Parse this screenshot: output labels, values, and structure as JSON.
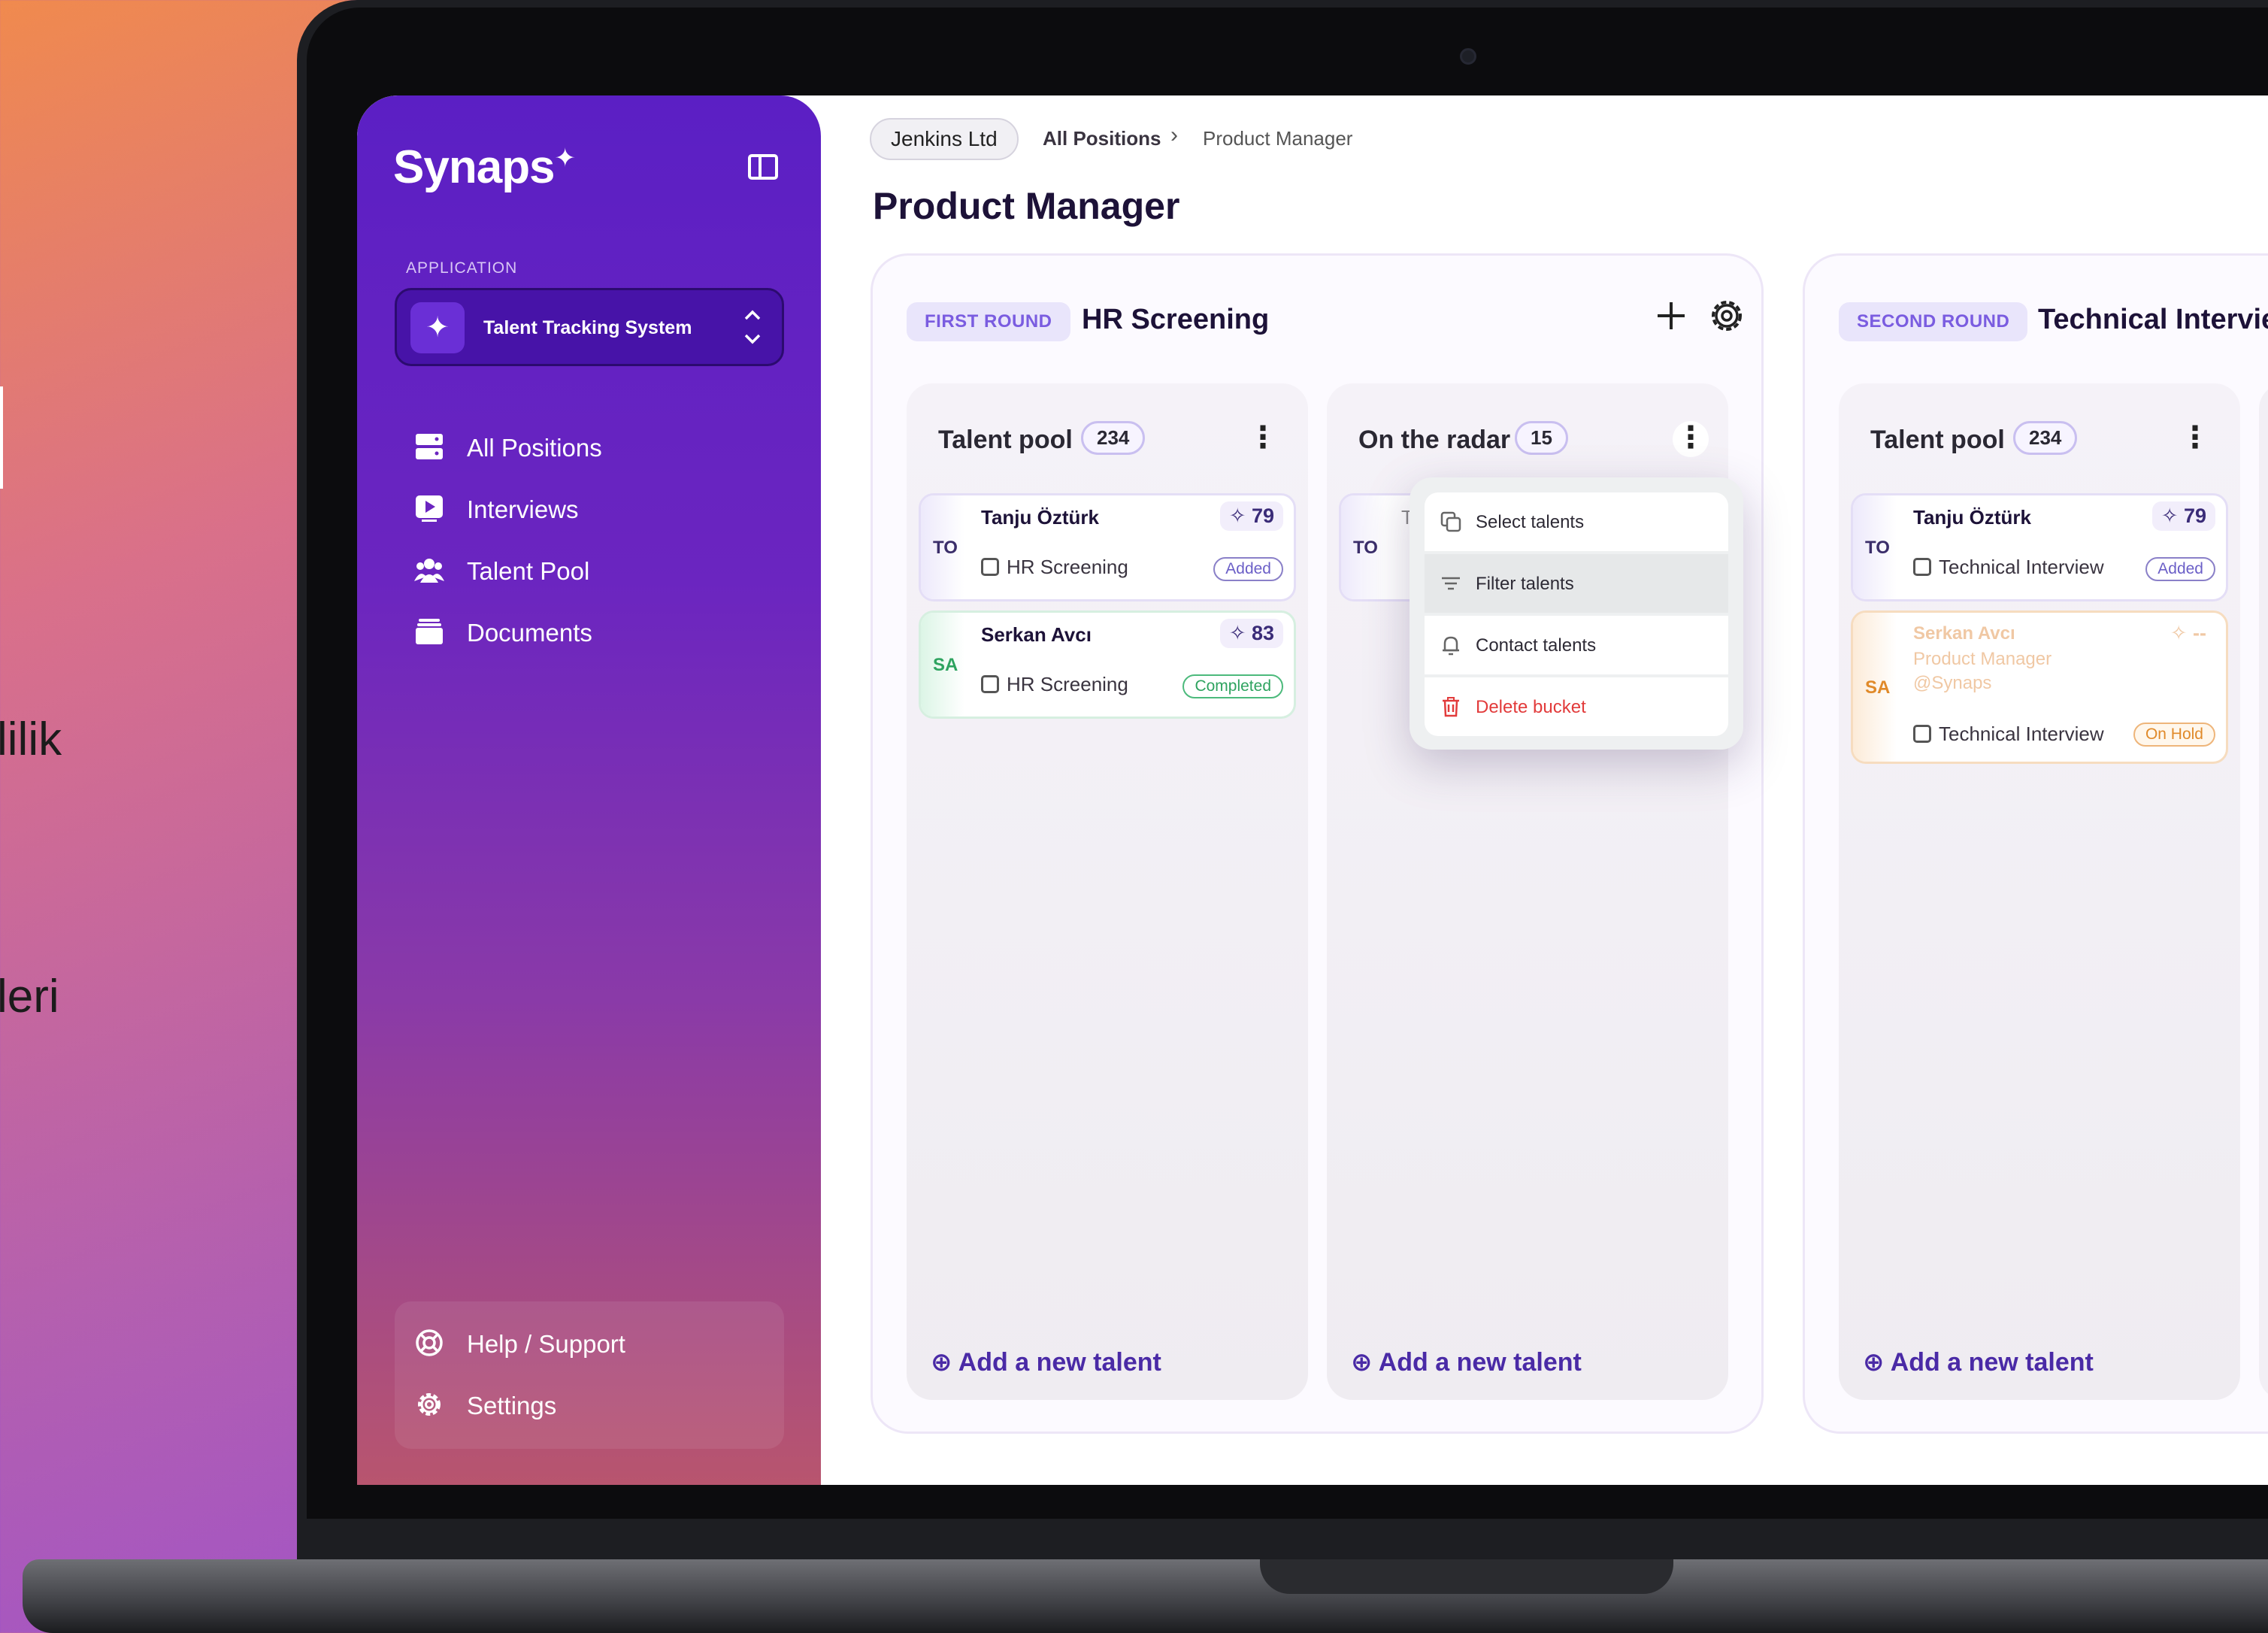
{
  "background_text": {
    "line1": "lilik",
    "line2": "leri"
  },
  "app": {
    "logo": "Synaps",
    "application_label": "APPLICATION",
    "application_name": "Talent Tracking System"
  },
  "sidebar": {
    "items": [
      {
        "label": "All Positions",
        "icon": "server-icon"
      },
      {
        "label": "Interviews",
        "icon": "play-icon"
      },
      {
        "label": "Talent Pool",
        "icon": "users-icon"
      },
      {
        "label": "Documents",
        "icon": "archive-icon"
      }
    ],
    "footer": [
      {
        "label": "Help / Support",
        "icon": "lifebuoy-icon"
      },
      {
        "label": "Settings",
        "icon": "gear-icon"
      }
    ]
  },
  "breadcrumb": {
    "org": "Jenkins Ltd",
    "section": "All Positions",
    "current": "Product Manager"
  },
  "page_title": "Product Manager",
  "rounds": [
    {
      "tag": "FIRST ROUND",
      "title": "HR Screening",
      "buckets": [
        {
          "title": "Talent pool",
          "count": "234",
          "cards": [
            {
              "initials": "TO",
              "name": "Tanju Öztürk",
              "score": "79",
              "stage": "HR Screening",
              "status": "Added"
            },
            {
              "initials": "SA",
              "name": "Serkan Avcı",
              "score": "83",
              "stage": "HR Screening",
              "status": "Completed"
            }
          ],
          "add_label": "Add a new talent"
        },
        {
          "title": "On the radar",
          "count": "15",
          "cards": [
            {
              "initials": "TO",
              "name": "Ta"
            }
          ],
          "add_label": "Add a new talent"
        }
      ]
    },
    {
      "tag": "SECOND ROUND",
      "title": "Technical Intervie",
      "buckets": [
        {
          "title": "Talent pool",
          "count": "234",
          "cards": [
            {
              "initials": "TO",
              "name": "Tanju Öztürk",
              "score": "79",
              "stage": "Technical Interview",
              "status": "Added"
            },
            {
              "initials": "SA",
              "name": "Serkan Avcı",
              "subtitle": "Product Manager",
              "org": "@Synaps",
              "score": "--",
              "stage": "Technical Interview",
              "status": "On Hold"
            }
          ],
          "add_label": "Add a new talent"
        }
      ]
    }
  ],
  "bucket_menu": {
    "items": [
      {
        "label": "Select talents",
        "icon": "copy-icon"
      },
      {
        "label": "Filter talents",
        "icon": "filter-icon"
      },
      {
        "label": "Contact talents",
        "icon": "bell-icon"
      },
      {
        "label": "Delete bucket",
        "icon": "trash-icon"
      }
    ]
  },
  "colors": {
    "sidebar_top": "#5b1fc4",
    "accent": "#4a2aa6",
    "danger": "#e23b3b",
    "status_added": "#6b5fc7",
    "status_completed": "#2ea35f",
    "status_on_hold": "#e08a2a"
  }
}
